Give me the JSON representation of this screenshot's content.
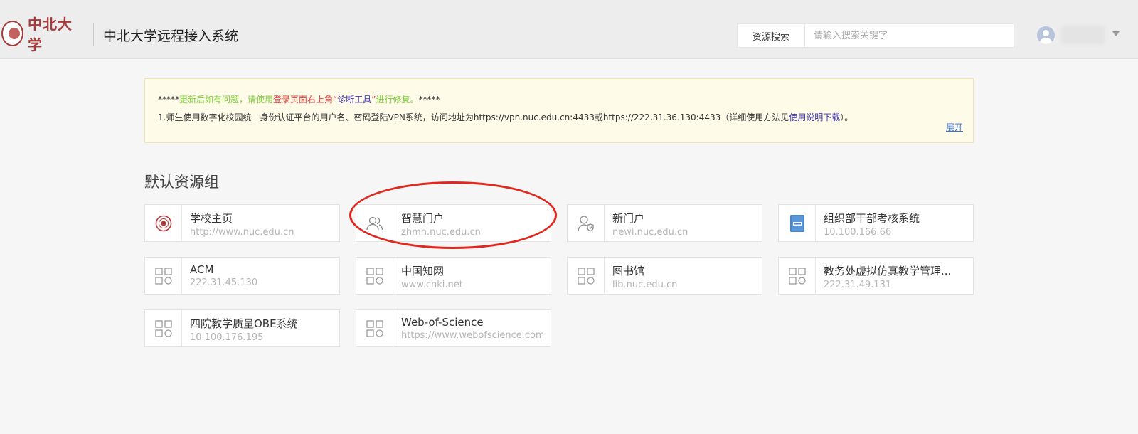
{
  "header": {
    "logo_text": "中北大学",
    "title": "中北大学远程接入系统",
    "search_label": "资源搜索",
    "search_placeholder": "请输入搜索关键字"
  },
  "notice": {
    "line1_prefix": "*****",
    "line1_green_a": "更新后如有问题，请使用",
    "line1_red": "登录页面右上角",
    "line1_quote_open": "“",
    "line1_blue": "诊断工具",
    "line1_quote_close": "”",
    "line1_green_b": "进行修复。",
    "line1_suffix": "*****",
    "line2_text": "1.师生使用数字化校园统一身份认证平台的用户名、密码登陆VPN系统，访问地址为https://vpn.nuc.edu.cn:4433或https://222.31.36.130:4433（详细使用方法见",
    "line2_link": "使用说明下载",
    "line2_end": "）。",
    "expand_label": "展开"
  },
  "group": {
    "title": "默认资源组",
    "items": [
      {
        "name": "学校主页",
        "url": "http://www.nuc.edu.cn",
        "icon": "school-seal-icon"
      },
      {
        "name": "智慧门户",
        "url": "zhmh.nuc.edu.cn",
        "icon": "users-icon"
      },
      {
        "name": "新门户",
        "url": "newi.nuc.edu.cn",
        "icon": "user-shield-icon"
      },
      {
        "name": "组织部干部考核系统",
        "url": "10.100.166.66",
        "icon": "book-icon"
      },
      {
        "name": "ACM",
        "url": "222.31.45.130",
        "icon": "app-grid-icon"
      },
      {
        "name": "中国知网",
        "url": "www.cnki.net",
        "icon": "app-grid-icon"
      },
      {
        "name": "图书馆",
        "url": "lib.nuc.edu.cn",
        "icon": "app-grid-icon"
      },
      {
        "name": "教务处虚拟仿真教学管理...",
        "url": "222.31.49.131",
        "icon": "app-grid-icon"
      },
      {
        "name": "四院教学质量OBE系统",
        "url": "10.100.176.195",
        "icon": "app-grid-icon"
      },
      {
        "name": "Web-of-Science",
        "url": "https://www.webofscience.com",
        "icon": "app-grid-icon"
      }
    ]
  },
  "colors": {
    "highlight": "#e0281e",
    "notice_bg": "#fefbe8",
    "green_text": "#7ccf3a",
    "red_text": "#e23c3c",
    "blue_text": "#3a2fb0"
  }
}
